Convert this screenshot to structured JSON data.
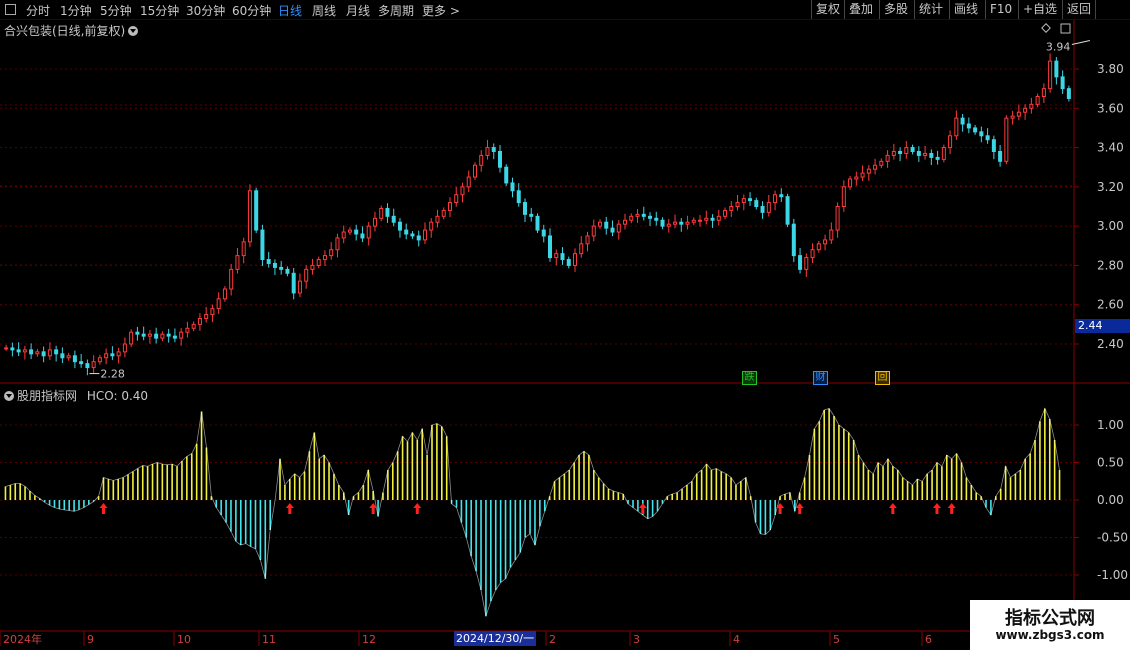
{
  "toolbar": {
    "periods": [
      "分时",
      "1分钟",
      "5分钟",
      "15分钟",
      "30分钟",
      "60分钟",
      "日线",
      "周线",
      "月线",
      "多周期",
      "更多 >"
    ],
    "active_period": "日线",
    "right_buttons": [
      "复权",
      "叠加",
      "多股",
      "统计",
      "画线",
      "F10",
      "+自选",
      "返回"
    ]
  },
  "main_panel": {
    "title": "合兴包装(日线,前复权)",
    "current_price_tag": "2.44",
    "high_label": "3.94",
    "low_label": "2.28",
    "badges": [
      {
        "text": "跌",
        "color": "#22c322"
      },
      {
        "text": "财",
        "color": "#2f8fff"
      },
      {
        "text": "回",
        "color": "#f0c000"
      }
    ]
  },
  "indicator_panel": {
    "title": "股朋指标网",
    "value_label": "HCO: 0.40"
  },
  "time_axis": {
    "labels": [
      "2024年",
      "9",
      "10",
      "11",
      "12",
      "2",
      "3",
      "4",
      "5",
      "6"
    ],
    "highlight": "2024/12/30/一"
  },
  "watermark": {
    "line1": "指标公式网",
    "line2": "www.zbgs3.com"
  },
  "colors": {
    "up": "#ff3b3b",
    "down": "#3cd6e6",
    "bar_pos": "#f2f23a",
    "bar_neg": "#40e6ee",
    "arrow": "#ff2020",
    "grid": "#5a0000"
  },
  "chart_data": [
    {
      "type": "candlestick",
      "title": "合兴包装(日线,前复权)",
      "ylim": [
        2.2,
        3.94
      ],
      "yticks": [
        2.4,
        2.6,
        2.8,
        3.0,
        3.2,
        3.4,
        3.6,
        3.8
      ],
      "ytick_labels": [
        "2.40",
        "2.60",
        "2.80",
        "3.00",
        "3.20",
        "3.40",
        "3.60",
        "3.80"
      ],
      "x_labels": [
        "2024年",
        "9",
        "10",
        "11",
        "12",
        "2",
        "3",
        "4",
        "5",
        "6"
      ],
      "series": [
        {
          "values": [
            2.38,
            2.37,
            2.36,
            2.37,
            2.35,
            2.36,
            2.34,
            2.37,
            2.35,
            2.33,
            2.34,
            2.31,
            2.3,
            2.28,
            2.31,
            2.33,
            2.35,
            2.34,
            2.36,
            2.4,
            2.46,
            2.45,
            2.44,
            2.45,
            2.43,
            2.45,
            2.44,
            2.43,
            2.46,
            2.48,
            2.5,
            2.53,
            2.55,
            2.58,
            2.63,
            2.68,
            2.78,
            2.85,
            2.92,
            3.18,
            2.98,
            2.83,
            2.81,
            2.79,
            2.78,
            2.76,
            2.66,
            2.72,
            2.78,
            2.8,
            2.83,
            2.85,
            2.88,
            2.94,
            2.97,
            2.98,
            2.96,
            2.94,
            3.0,
            3.04,
            3.09,
            3.05,
            3.02,
            2.98,
            2.96,
            2.95,
            2.93,
            2.98,
            3.02,
            3.05,
            3.08,
            3.12,
            3.16,
            3.2,
            3.25,
            3.31,
            3.36,
            3.4,
            3.38,
            3.3,
            3.22,
            3.18,
            3.12,
            3.06,
            3.05,
            2.98,
            2.95,
            2.84,
            2.86,
            2.83,
            2.8,
            2.86,
            2.91,
            2.95,
            3.0,
            3.02,
            2.99,
            2.97,
            3.01,
            3.03,
            3.05,
            3.06,
            3.05,
            3.04,
            3.03,
            3.0,
            3.01,
            3.02,
            3.01,
            3.02,
            3.03,
            3.03,
            3.04,
            3.03,
            3.05,
            3.08,
            3.1,
            3.12,
            3.14,
            3.13,
            3.1,
            3.07,
            3.12,
            3.16,
            3.15,
            3.01,
            2.85,
            2.78,
            2.84,
            2.88,
            2.91,
            2.93,
            2.98,
            3.1,
            3.2,
            3.24,
            3.25,
            3.27,
            3.29,
            3.31,
            3.33,
            3.36,
            3.38,
            3.37,
            3.4,
            3.38,
            3.36,
            3.37,
            3.35,
            3.34,
            3.4,
            3.46,
            3.55,
            3.52,
            3.5,
            3.48,
            3.46,
            3.44,
            3.38,
            3.33,
            3.55,
            3.56,
            3.58,
            3.6,
            3.62,
            3.66,
            3.7,
            3.84,
            3.76,
            3.7,
            3.65
          ]
        }
      ],
      "annotations": [
        {
          "text": "3.94",
          "x": 174,
          "y": 3.94
        },
        {
          "text": "2.28",
          "x": 13,
          "y": 2.28
        }
      ]
    },
    {
      "type": "bar",
      "title": "股朋指标网",
      "ylim": [
        -1.35,
        1.35
      ],
      "yticks": [
        1.0,
        0.5,
        0.0,
        -0.5,
        -1.0
      ],
      "ytick_labels": [
        "1.00",
        "0.50",
        "0.00",
        "-0.50",
        "-1.00"
      ],
      "series": [
        {
          "name": "HCO",
          "values": [
            0.18,
            0.2,
            0.22,
            0.22,
            0.18,
            0.12,
            0.06,
            0.02,
            -0.03,
            -0.07,
            -0.1,
            -0.12,
            -0.13,
            -0.14,
            -0.15,
            -0.13,
            -0.1,
            -0.06,
            -0.02,
            0.05,
            0.3,
            0.28,
            0.26,
            0.28,
            0.3,
            0.34,
            0.38,
            0.42,
            0.46,
            0.45,
            0.48,
            0.5,
            0.48,
            0.47,
            0.48,
            0.45,
            0.52,
            0.58,
            0.62,
            0.75,
            1.18,
            0.7,
            0.05,
            -0.1,
            -0.2,
            -0.3,
            -0.42,
            -0.55,
            -0.6,
            -0.58,
            -0.62,
            -0.65,
            -0.8,
            -1.05,
            -0.4,
            0.0,
            0.55,
            0.2,
            0.28,
            0.35,
            0.3,
            0.38,
            0.65,
            0.9,
            0.55,
            0.6,
            0.5,
            0.35,
            0.2,
            0.1,
            -0.2,
            0.05,
            0.1,
            0.2,
            0.4,
            0.12,
            -0.22,
            0.1,
            0.4,
            0.5,
            0.65,
            0.85,
            0.78,
            0.9,
            0.8,
            0.95,
            0.6,
            1.0,
            1.02,
            0.98,
            0.85,
            -0.05,
            -0.1,
            -0.3,
            -0.5,
            -0.75,
            -0.95,
            -1.2,
            -1.55,
            -1.35,
            -1.2,
            -1.1,
            -1.05,
            -0.9,
            -0.8,
            -0.7,
            -0.5,
            -0.45,
            -0.6,
            -0.35,
            -0.15,
            0.05,
            0.25,
            0.3,
            0.35,
            0.4,
            0.5,
            0.6,
            0.65,
            0.6,
            0.4,
            0.3,
            0.22,
            0.15,
            0.12,
            0.1,
            0.08,
            -0.05,
            -0.1,
            -0.15,
            -0.2,
            -0.25,
            -0.22,
            -0.15,
            -0.05,
            0.05,
            0.08,
            0.1,
            0.15,
            0.2,
            0.25,
            0.35,
            0.4,
            0.48,
            0.4,
            0.42,
            0.38,
            0.35,
            0.3,
            0.2,
            0.25,
            0.3,
            0.05,
            -0.3,
            -0.45,
            -0.46,
            -0.4,
            -0.2,
            0.05,
            0.08,
            0.1,
            -0.15,
            0.1,
            0.3,
            0.6,
            0.95,
            1.05,
            1.2,
            1.22,
            1.12,
            1.0,
            0.95,
            0.9,
            0.8,
            0.6,
            0.5,
            0.4,
            0.35,
            0.5,
            0.45,
            0.55,
            0.45,
            0.4,
            0.3,
            0.25,
            0.2,
            0.28,
            0.25,
            0.35,
            0.4,
            0.5,
            0.45,
            0.6,
            0.55,
            0.62,
            0.5,
            0.3,
            0.2,
            0.1,
            0.05,
            -0.1,
            -0.2,
            0.05,
            0.15,
            0.45,
            0.3,
            0.35,
            0.4,
            0.55,
            0.62,
            0.8,
            1.05,
            1.22,
            1.08,
            0.8,
            0.4
          ]
        }
      ],
      "signal_arrows": [
        20,
        58,
        75,
        84,
        130,
        158,
        162,
        181,
        190,
        193,
        247
      ]
    }
  ]
}
